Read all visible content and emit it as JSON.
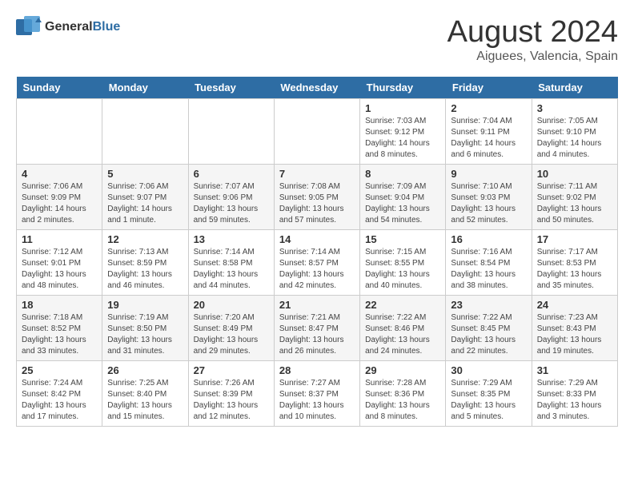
{
  "header": {
    "logo_general": "General",
    "logo_blue": "Blue",
    "title": "August 2024",
    "subtitle": "Aiguees, Valencia, Spain"
  },
  "calendar": {
    "weekdays": [
      "Sunday",
      "Monday",
      "Tuesday",
      "Wednesday",
      "Thursday",
      "Friday",
      "Saturday"
    ],
    "weeks": [
      [
        {
          "day": "",
          "info": ""
        },
        {
          "day": "",
          "info": ""
        },
        {
          "day": "",
          "info": ""
        },
        {
          "day": "",
          "info": ""
        },
        {
          "day": "1",
          "info": "Sunrise: 7:03 AM\nSunset: 9:12 PM\nDaylight: 14 hours\nand 8 minutes."
        },
        {
          "day": "2",
          "info": "Sunrise: 7:04 AM\nSunset: 9:11 PM\nDaylight: 14 hours\nand 6 minutes."
        },
        {
          "day": "3",
          "info": "Sunrise: 7:05 AM\nSunset: 9:10 PM\nDaylight: 14 hours\nand 4 minutes."
        }
      ],
      [
        {
          "day": "4",
          "info": "Sunrise: 7:06 AM\nSunset: 9:09 PM\nDaylight: 14 hours\nand 2 minutes."
        },
        {
          "day": "5",
          "info": "Sunrise: 7:06 AM\nSunset: 9:07 PM\nDaylight: 14 hours\nand 1 minute."
        },
        {
          "day": "6",
          "info": "Sunrise: 7:07 AM\nSunset: 9:06 PM\nDaylight: 13 hours\nand 59 minutes."
        },
        {
          "day": "7",
          "info": "Sunrise: 7:08 AM\nSunset: 9:05 PM\nDaylight: 13 hours\nand 57 minutes."
        },
        {
          "day": "8",
          "info": "Sunrise: 7:09 AM\nSunset: 9:04 PM\nDaylight: 13 hours\nand 54 minutes."
        },
        {
          "day": "9",
          "info": "Sunrise: 7:10 AM\nSunset: 9:03 PM\nDaylight: 13 hours\nand 52 minutes."
        },
        {
          "day": "10",
          "info": "Sunrise: 7:11 AM\nSunset: 9:02 PM\nDaylight: 13 hours\nand 50 minutes."
        }
      ],
      [
        {
          "day": "11",
          "info": "Sunrise: 7:12 AM\nSunset: 9:01 PM\nDaylight: 13 hours\nand 48 minutes."
        },
        {
          "day": "12",
          "info": "Sunrise: 7:13 AM\nSunset: 8:59 PM\nDaylight: 13 hours\nand 46 minutes."
        },
        {
          "day": "13",
          "info": "Sunrise: 7:14 AM\nSunset: 8:58 PM\nDaylight: 13 hours\nand 44 minutes."
        },
        {
          "day": "14",
          "info": "Sunrise: 7:14 AM\nSunset: 8:57 PM\nDaylight: 13 hours\nand 42 minutes."
        },
        {
          "day": "15",
          "info": "Sunrise: 7:15 AM\nSunset: 8:55 PM\nDaylight: 13 hours\nand 40 minutes."
        },
        {
          "day": "16",
          "info": "Sunrise: 7:16 AM\nSunset: 8:54 PM\nDaylight: 13 hours\nand 38 minutes."
        },
        {
          "day": "17",
          "info": "Sunrise: 7:17 AM\nSunset: 8:53 PM\nDaylight: 13 hours\nand 35 minutes."
        }
      ],
      [
        {
          "day": "18",
          "info": "Sunrise: 7:18 AM\nSunset: 8:52 PM\nDaylight: 13 hours\nand 33 minutes."
        },
        {
          "day": "19",
          "info": "Sunrise: 7:19 AM\nSunset: 8:50 PM\nDaylight: 13 hours\nand 31 minutes."
        },
        {
          "day": "20",
          "info": "Sunrise: 7:20 AM\nSunset: 8:49 PM\nDaylight: 13 hours\nand 29 minutes."
        },
        {
          "day": "21",
          "info": "Sunrise: 7:21 AM\nSunset: 8:47 PM\nDaylight: 13 hours\nand 26 minutes."
        },
        {
          "day": "22",
          "info": "Sunrise: 7:22 AM\nSunset: 8:46 PM\nDaylight: 13 hours\nand 24 minutes."
        },
        {
          "day": "23",
          "info": "Sunrise: 7:22 AM\nSunset: 8:45 PM\nDaylight: 13 hours\nand 22 minutes."
        },
        {
          "day": "24",
          "info": "Sunrise: 7:23 AM\nSunset: 8:43 PM\nDaylight: 13 hours\nand 19 minutes."
        }
      ],
      [
        {
          "day": "25",
          "info": "Sunrise: 7:24 AM\nSunset: 8:42 PM\nDaylight: 13 hours\nand 17 minutes."
        },
        {
          "day": "26",
          "info": "Sunrise: 7:25 AM\nSunset: 8:40 PM\nDaylight: 13 hours\nand 15 minutes."
        },
        {
          "day": "27",
          "info": "Sunrise: 7:26 AM\nSunset: 8:39 PM\nDaylight: 13 hours\nand 12 minutes."
        },
        {
          "day": "28",
          "info": "Sunrise: 7:27 AM\nSunset: 8:37 PM\nDaylight: 13 hours\nand 10 minutes."
        },
        {
          "day": "29",
          "info": "Sunrise: 7:28 AM\nSunset: 8:36 PM\nDaylight: 13 hours\nand 8 minutes."
        },
        {
          "day": "30",
          "info": "Sunrise: 7:29 AM\nSunset: 8:35 PM\nDaylight: 13 hours\nand 5 minutes."
        },
        {
          "day": "31",
          "info": "Sunrise: 7:29 AM\nSunset: 8:33 PM\nDaylight: 13 hours\nand 3 minutes."
        }
      ]
    ]
  }
}
